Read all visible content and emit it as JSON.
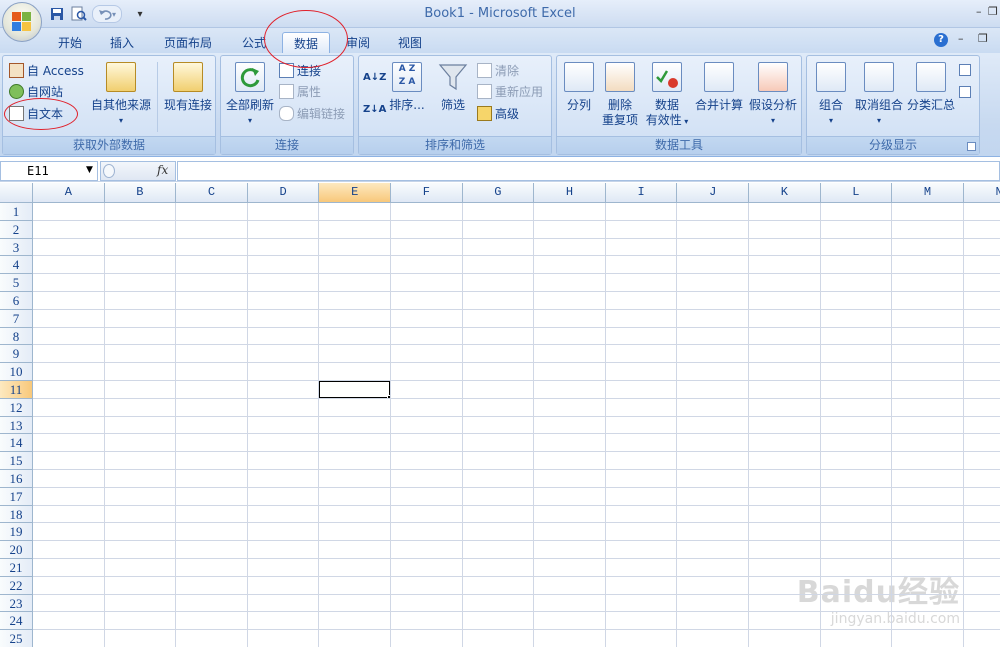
{
  "window": {
    "title": "Book1 - Microsoft Excel",
    "minimize": "–",
    "restore": "❐"
  },
  "qat": {
    "save": "save-icon",
    "print_preview": "print-preview-icon",
    "undo": "undo-icon",
    "customize": "▾"
  },
  "tabs": [
    {
      "label": "开始"
    },
    {
      "label": "插入"
    },
    {
      "label": "页面布局"
    },
    {
      "label": "公式"
    },
    {
      "label": "数据",
      "active": true
    },
    {
      "label": "审阅"
    },
    {
      "label": "视图"
    }
  ],
  "ribbon_right": {
    "help": "?",
    "minimize": "–",
    "restore": "❐"
  },
  "groups": {
    "external": {
      "label": "获取外部数据",
      "access": "自 Access",
      "web": "自网站",
      "text": "自文本",
      "other": "自其他来源",
      "existing": "现有连接"
    },
    "connections": {
      "label": "连接",
      "refresh_all": "全部刷新",
      "connections": "连接",
      "properties": "属性",
      "edit_links": "编辑链接"
    },
    "sort_filter": {
      "label": "排序和筛选",
      "sort": "排序...",
      "filter": "筛选",
      "clear": "清除",
      "reapply": "重新应用",
      "advanced": "高级"
    },
    "data_tools": {
      "label": "数据工具",
      "text_to_columns": "分列",
      "remove_duplicates_1": "删除",
      "remove_duplicates_2": "重复项",
      "validation_1": "数据",
      "validation_2": "有效性",
      "consolidate": "合并计算",
      "what_if": "假设分析"
    },
    "outline": {
      "label": "分级显示",
      "group": "组合",
      "ungroup": "取消组合",
      "subtotal": "分类汇总"
    }
  },
  "formula_bar": {
    "name_box": "E11",
    "fx": "fx",
    "formula": ""
  },
  "sheet": {
    "columns": [
      "A",
      "B",
      "C",
      "D",
      "E",
      "F",
      "G",
      "H",
      "I",
      "J",
      "K",
      "L",
      "M",
      "N"
    ],
    "rows": [
      "1",
      "2",
      "3",
      "4",
      "5",
      "6",
      "7",
      "8",
      "9",
      "10",
      "11",
      "12",
      "13",
      "14",
      "15",
      "16",
      "17",
      "18",
      "19",
      "20",
      "21",
      "22",
      "23",
      "24",
      "25"
    ],
    "selected_col": "E",
    "selected_row": "11"
  },
  "watermark": {
    "brand": "Baidu经验",
    "url": "jingyan.baidu.com"
  }
}
